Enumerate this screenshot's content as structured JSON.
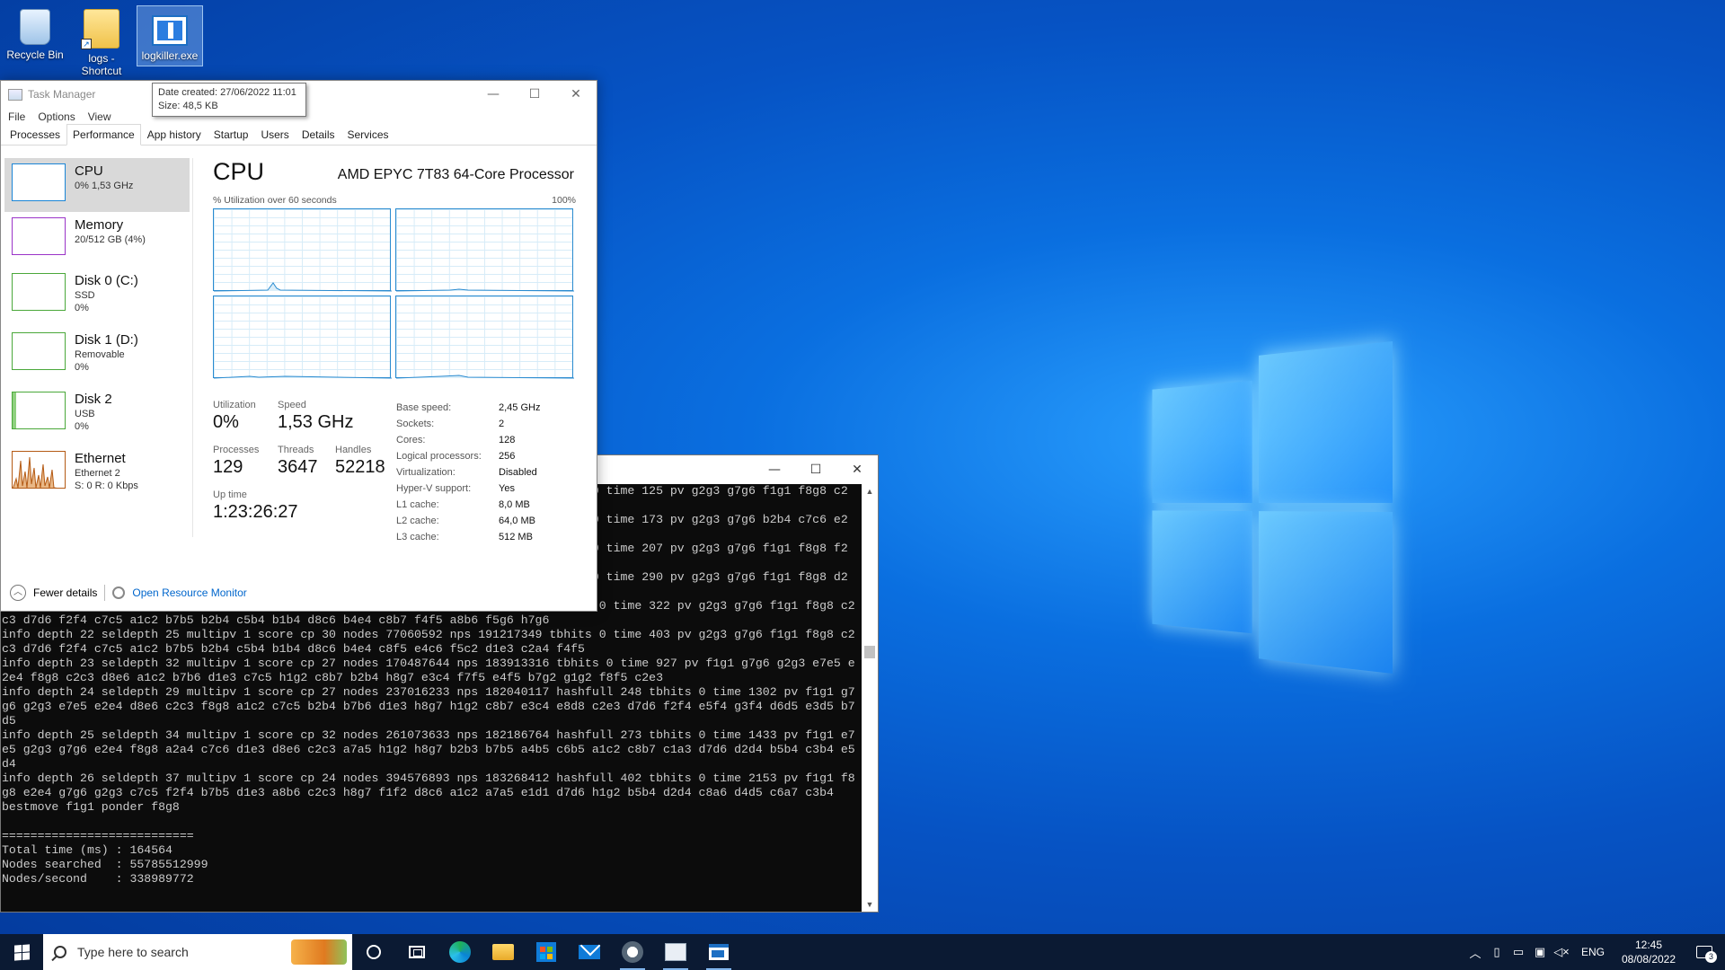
{
  "desktop": {
    "icons": [
      {
        "label": "Recycle Bin"
      },
      {
        "label": "logs - Shortcut"
      },
      {
        "label": "logkiller.exe"
      }
    ],
    "tooltip": {
      "line1": "Date created: 27/06/2022 11:01",
      "line2": "Size: 48,5 KB"
    }
  },
  "task_manager": {
    "title": "Task Manager",
    "menu": [
      "File",
      "Options",
      "View"
    ],
    "tabs": [
      "Processes",
      "Performance",
      "App history",
      "Startup",
      "Users",
      "Details",
      "Services"
    ],
    "active_tab": "Performance",
    "sidebar": [
      {
        "name": "CPU",
        "sub1": "0% 1,53 GHz",
        "sub2": "",
        "sub3": "",
        "color": "#1a85d6"
      },
      {
        "name": "Memory",
        "sub1": "20/512 GB (4%)",
        "sub2": "",
        "sub3": "",
        "color": "#9b34c8"
      },
      {
        "name": "Disk 0 (C:)",
        "sub1": "SSD",
        "sub2": "0%",
        "sub3": "",
        "color": "#4aa83a"
      },
      {
        "name": "Disk 1 (D:)",
        "sub1": "Removable",
        "sub2": "0%",
        "sub3": "",
        "color": "#4aa83a"
      },
      {
        "name": "Disk 2",
        "sub1": "USB",
        "sub2": "0%",
        "sub3": "",
        "color": "#4aa83a"
      },
      {
        "name": "Ethernet",
        "sub1": "Ethernet 2",
        "sub2": "S: 0 R: 0 Kbps",
        "sub3": "",
        "color": "#b45a14"
      }
    ],
    "main": {
      "title": "CPU",
      "processor": "AMD EPYC 7T83 64-Core Processor",
      "graph_label": "% Utilization over 60 seconds",
      "graph_max": "100%",
      "utilization_label": "Utilization",
      "utilization": "0%",
      "speed_label": "Speed",
      "speed": "1,53 GHz",
      "processes_label": "Processes",
      "processes": "129",
      "threads_label": "Threads",
      "threads": "3647",
      "handles_label": "Handles",
      "handles": "52218",
      "uptime_label": "Up time",
      "uptime": "1:23:26:27",
      "specs": [
        {
          "k": "Base speed:",
          "v": "2,45 GHz"
        },
        {
          "k": "Sockets:",
          "v": "2"
        },
        {
          "k": "Cores:",
          "v": "128"
        },
        {
          "k": "Logical processors:",
          "v": "256"
        },
        {
          "k": "Virtualization:",
          "v": "Disabled"
        },
        {
          "k": "Hyper-V support:",
          "v": "Yes"
        },
        {
          "k": "L1 cache:",
          "v": "8,0 MB"
        },
        {
          "k": "L2 cache:",
          "v": "64,0 MB"
        },
        {
          "k": "L3 cache:",
          "v": "512 MB"
        }
      ]
    },
    "footer": {
      "fewer_details": "Fewer details",
      "resource_monitor": "Open Resource Monitor"
    }
  },
  "console": {
    "lines": [
      "                                                                                   0 time 125 pv g2g3 g7g6 f1g1 f8g8 c2",
      "",
      "                                                                                   0 time 173 pv g2g3 g7g6 b2b4 c7c6 e2",
      "",
      "                                                                                   0 time 207 pv g2g3 g7g6 f1g1 f8g8 f2",
      "",
      "                                                                                   0 time 290 pv g2g3 g7g6 f1g1 f8g8 d2",
      "",
      "info depth 21 seldepth 27 multipv 1 score cp 36 nodes 61860308 nps 192112757 tbhits 0 time 322 pv g2g3 g7g6 f1g1 f8g8 c2",
      "c3 d7d6 f2f4 c7c5 a1c2 b7b5 b2b4 c5b4 b1b4 d8c6 b4e4 c8b7 f4f5 a8b6 f5g6 h7g6",
      "info depth 22 seldepth 25 multipv 1 score cp 30 nodes 77060592 nps 191217349 tbhits 0 time 403 pv g2g3 g7g6 f1g1 f8g8 c2",
      "c3 d7d6 f2f4 c7c5 a1c2 b7b5 b2b4 c5b4 b1b4 d8c6 b4e4 c8f5 e4c6 f5c2 d1e3 c2a4 f4f5",
      "info depth 23 seldepth 32 multipv 1 score cp 27 nodes 170487644 nps 183913316 tbhits 0 time 927 pv f1g1 g7g6 g2g3 e7e5 e",
      "2e4 f8g8 c2c3 d8e6 a1c2 b7b6 d1e3 c7c5 h1g2 c8b7 b2b4 h8g7 e3c4 f7f5 e4f5 b7g2 g1g2 f8f5 c2e3",
      "info depth 24 seldepth 29 multipv 1 score cp 27 nodes 237016233 nps 182040117 hashfull 248 tbhits 0 time 1302 pv f1g1 g7",
      "g6 g2g3 e7e5 e2e4 d8e6 c2c3 f8g8 a1c2 c7c5 b2b4 b7b6 d1e3 h8g7 h1g2 c8b7 e3c4 e8d8 c2e3 d7d6 f2f4 e5f4 g3f4 d6d5 e3d5 b7",
      "d5",
      "info depth 25 seldepth 34 multipv 1 score cp 32 nodes 261073633 nps 182186764 hashfull 273 tbhits 0 time 1433 pv f1g1 e7",
      "e5 g2g3 g7g6 e2e4 f8g8 a2a4 c7c6 d1e3 d8e6 c2c3 a7a5 h1g2 h8g7 b2b3 b7b5 a4b5 c6b5 a1c2 c8b7 c1a3 d7d6 d2d4 b5b4 c3b4 e5",
      "d4",
      "info depth 26 seldepth 37 multipv 1 score cp 24 nodes 394576893 nps 183268412 hashfull 402 tbhits 0 time 2153 pv f1g1 f8",
      "g8 e2e4 g7g6 g2g3 c7c5 f2f4 b7b5 d1e3 a8b6 c2c3 h8g7 f1f2 d8c6 a1c2 a7a5 e1d1 d7d6 h1g2 b5b4 d2d4 c8a6 d4d5 c6a7 c3b4",
      "bestmove f1g1 ponder f8g8",
      "",
      "===========================",
      "Total time (ms) : 164564",
      "Nodes searched  : 55785512999",
      "Nodes/second    : 338989772"
    ]
  },
  "taskbar": {
    "search_placeholder": "Type here to search",
    "lang": "ENG",
    "time": "12:45",
    "date": "08/08/2022",
    "notification_count": "3"
  }
}
